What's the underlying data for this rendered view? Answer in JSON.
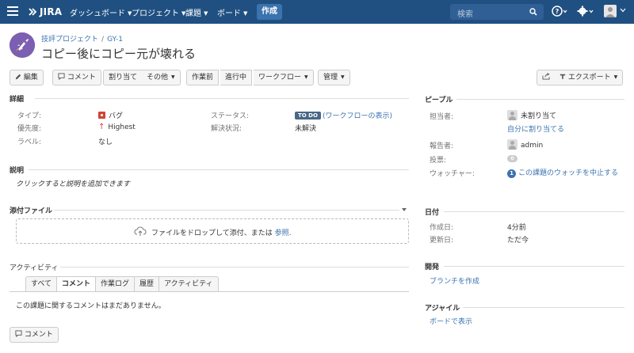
{
  "nav": {
    "logo": "JIRA",
    "items": [
      {
        "label": "ダッシュボード"
      },
      {
        "label": "プロジェクト"
      },
      {
        "label": "課題"
      },
      {
        "label": "ボード"
      }
    ],
    "create_label": "作成",
    "search_placeholder": "検索"
  },
  "header": {
    "project": "技評プロジェクト",
    "issue_key": "GY-1",
    "title": "コピー後にコピー元が壊れる"
  },
  "toolbar": {
    "edit": "編集",
    "comment": "コメント",
    "assign": "割り当て",
    "more": "その他",
    "before_work": "作業前",
    "in_progress": "進行中",
    "workflow": "ワークフロー",
    "admin": "管理",
    "export": "エクスポート"
  },
  "details": {
    "section_title": "詳細",
    "type_label": "タイプ:",
    "type_value": "バグ",
    "priority_label": "優先度:",
    "priority_value": "Highest",
    "labels_label": "ラベル:",
    "labels_value": "なし",
    "status_label": "ステータス:",
    "status_badge": "TO DO",
    "status_link": "(ワークフローの表示)",
    "resolution_label": "解決状況:",
    "resolution_value": "未解決"
  },
  "description": {
    "section_title": "説明",
    "placeholder": "クリックすると説明を追加できます"
  },
  "attachments": {
    "section_title": "添付ファイル",
    "drop_text": "ファイルをドロップして添付、または",
    "browse_link": "参照",
    "drop_suffix": "."
  },
  "activity": {
    "section_title": "アクティビティ",
    "tabs": [
      {
        "label": "すべて"
      },
      {
        "label": "コメント"
      },
      {
        "label": "作業ログ"
      },
      {
        "label": "履歴"
      },
      {
        "label": "アクティビティ"
      }
    ],
    "empty_message": "この課題に関するコメントはまだありません。",
    "comment_button": "コメント"
  },
  "people": {
    "section_title": "ピープル",
    "assignee_label": "担当者:",
    "assignee_value": "未割り当て",
    "assign_to_me": "自分に割り当てる",
    "reporter_label": "報告者:",
    "reporter_value": "admin",
    "votes_label": "投票:",
    "votes_count": "0",
    "watchers_label": "ウォッチャー:",
    "watchers_count": "1",
    "stop_watching": "この課題のウォッチを中止する"
  },
  "dates": {
    "section_title": "日付",
    "created_label": "作成日:",
    "created_value": "4分前",
    "updated_label": "更新日:",
    "updated_value": "ただ今"
  },
  "development": {
    "section_title": "開発",
    "create_branch": "ブランチを作成"
  },
  "agile": {
    "section_title": "アジャイル",
    "view_on_board": "ボードで表示"
  },
  "colors": {
    "nav_bg": "#205081",
    "link": "#3b73af",
    "bug": "#d04437",
    "todo": "#4a6785"
  }
}
